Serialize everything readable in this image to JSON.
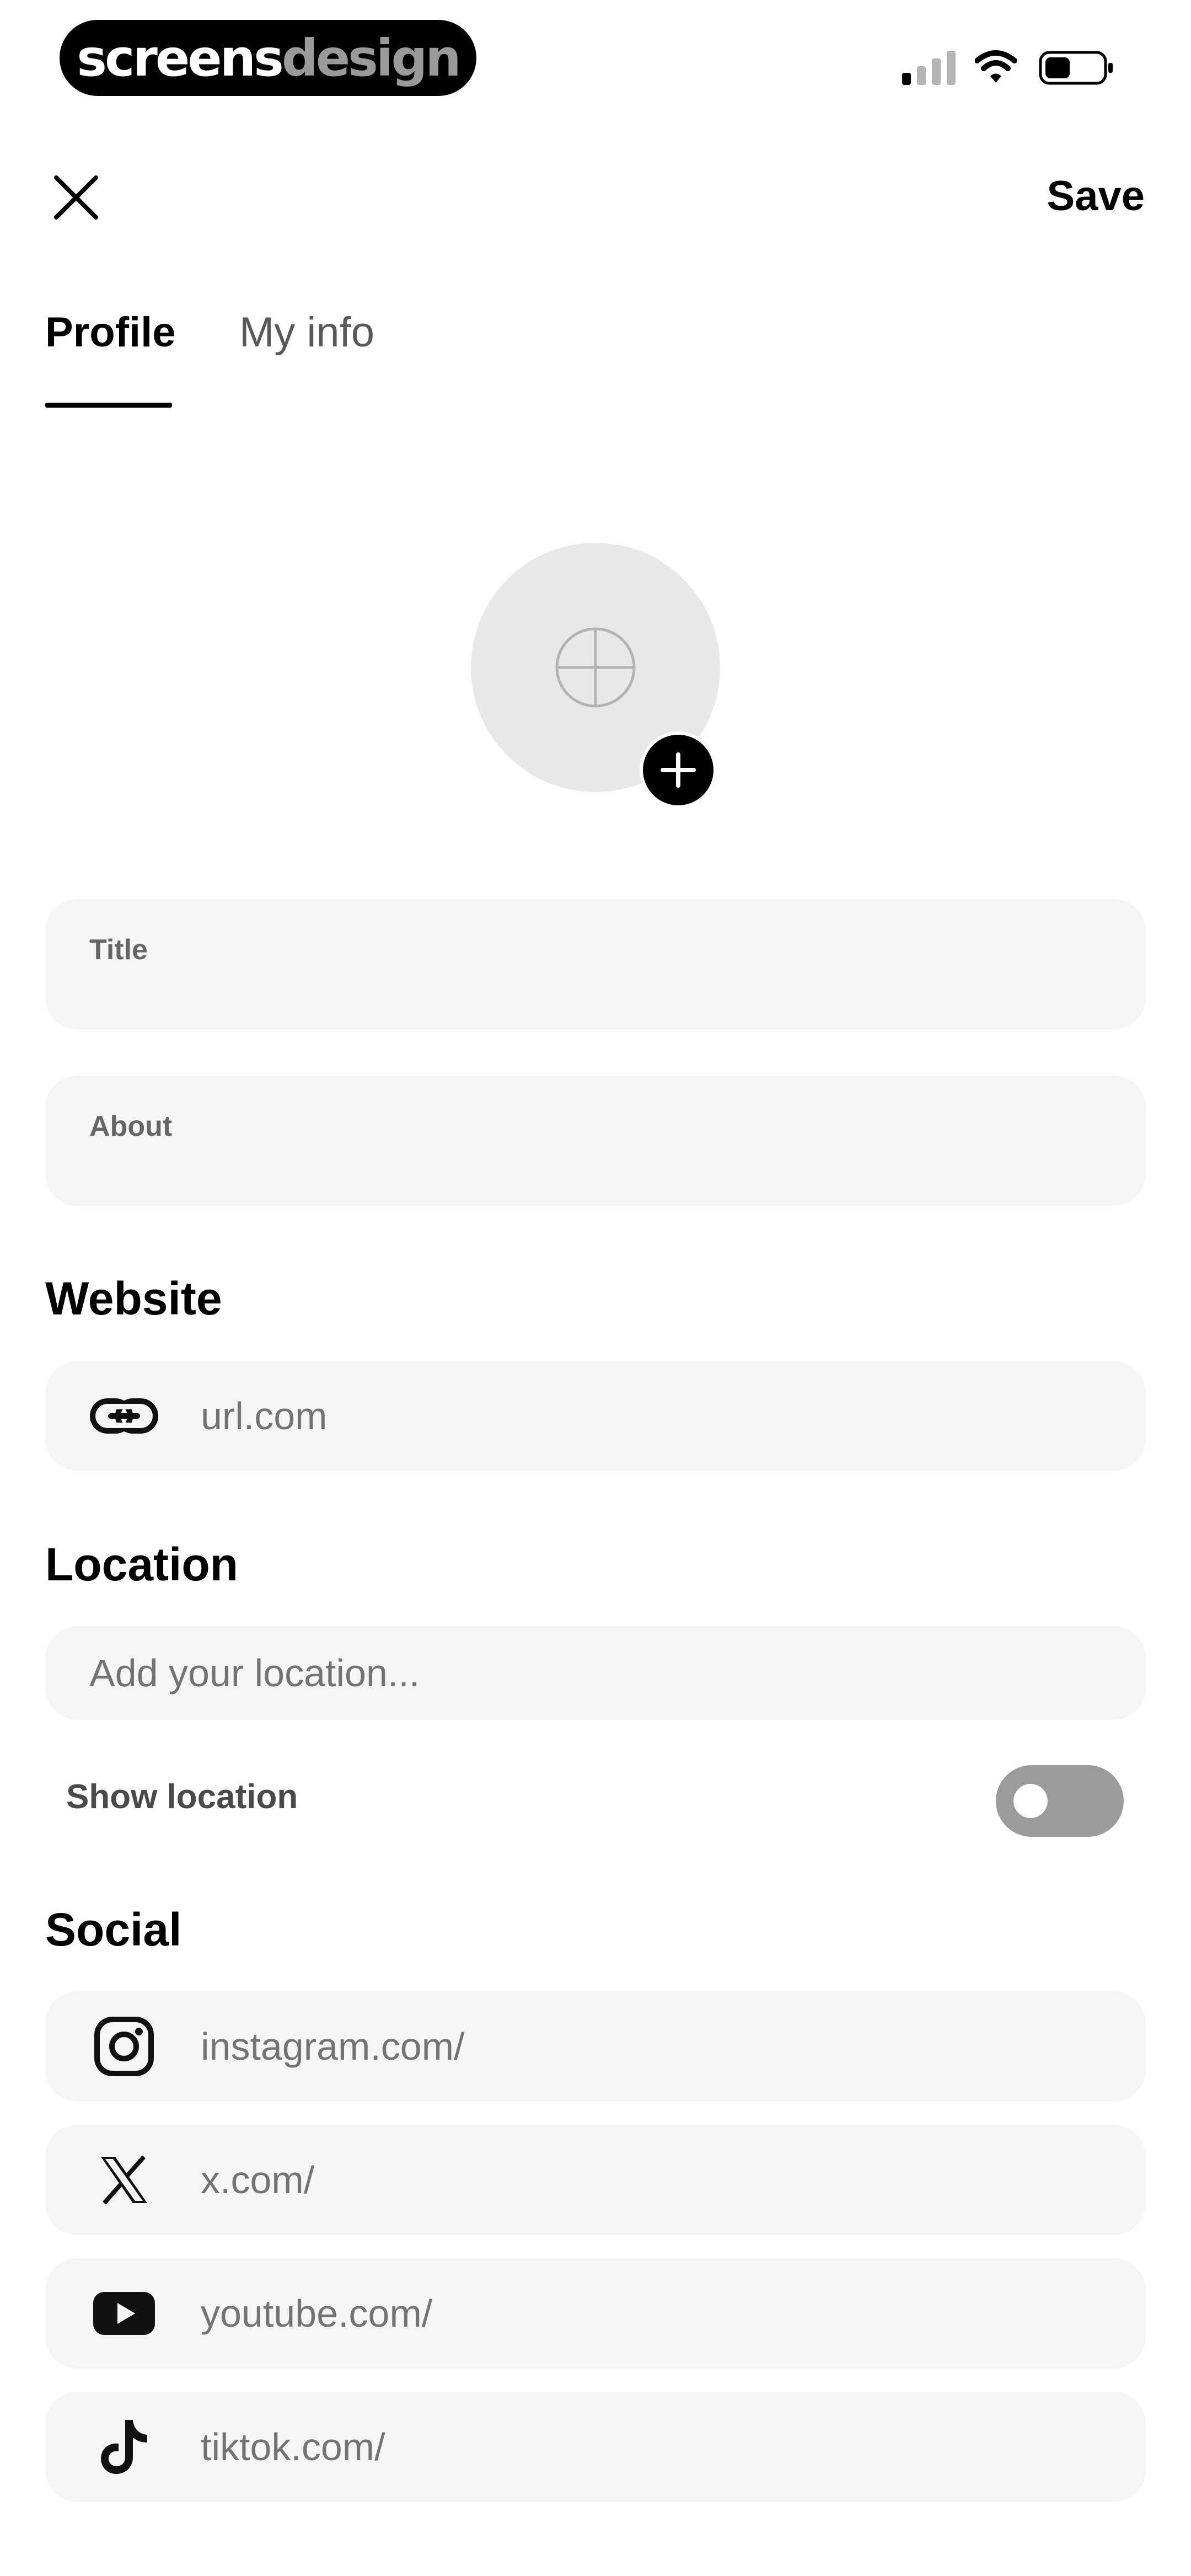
{
  "status_bar": {
    "brand_part1": "screens",
    "brand_part2": "design",
    "icons": [
      "signal-icon",
      "wifi-icon",
      "battery-icon"
    ]
  },
  "header": {
    "close_icon": "close-icon",
    "save_label": "Save"
  },
  "tabs": [
    {
      "label": "Profile",
      "active": true
    },
    {
      "label": "My info",
      "active": false
    }
  ],
  "avatar": {
    "placeholder_icon": "crosshair-icon",
    "add_icon": "plus-icon"
  },
  "fields": {
    "title_label": "Title",
    "about_label": "About"
  },
  "website": {
    "heading": "Website",
    "placeholder": "url.com",
    "icon": "link-icon"
  },
  "location": {
    "heading": "Location",
    "placeholder": "Add your location...",
    "show_label": "Show location",
    "show_enabled": false
  },
  "social": {
    "heading": "Social",
    "items": [
      {
        "placeholder": "instagram.com/",
        "icon": "instagram-icon"
      },
      {
        "placeholder": "x.com/",
        "icon": "x-logo-icon"
      },
      {
        "placeholder": "youtube.com/",
        "icon": "youtube-icon"
      },
      {
        "placeholder": "tiktok.com/",
        "icon": "tiktok-icon"
      }
    ]
  },
  "colors": {
    "accent": "#000000",
    "field_background": "#f5f5f5",
    "placeholder_text": "#737373",
    "toggle_off": "#9b9b9b"
  }
}
